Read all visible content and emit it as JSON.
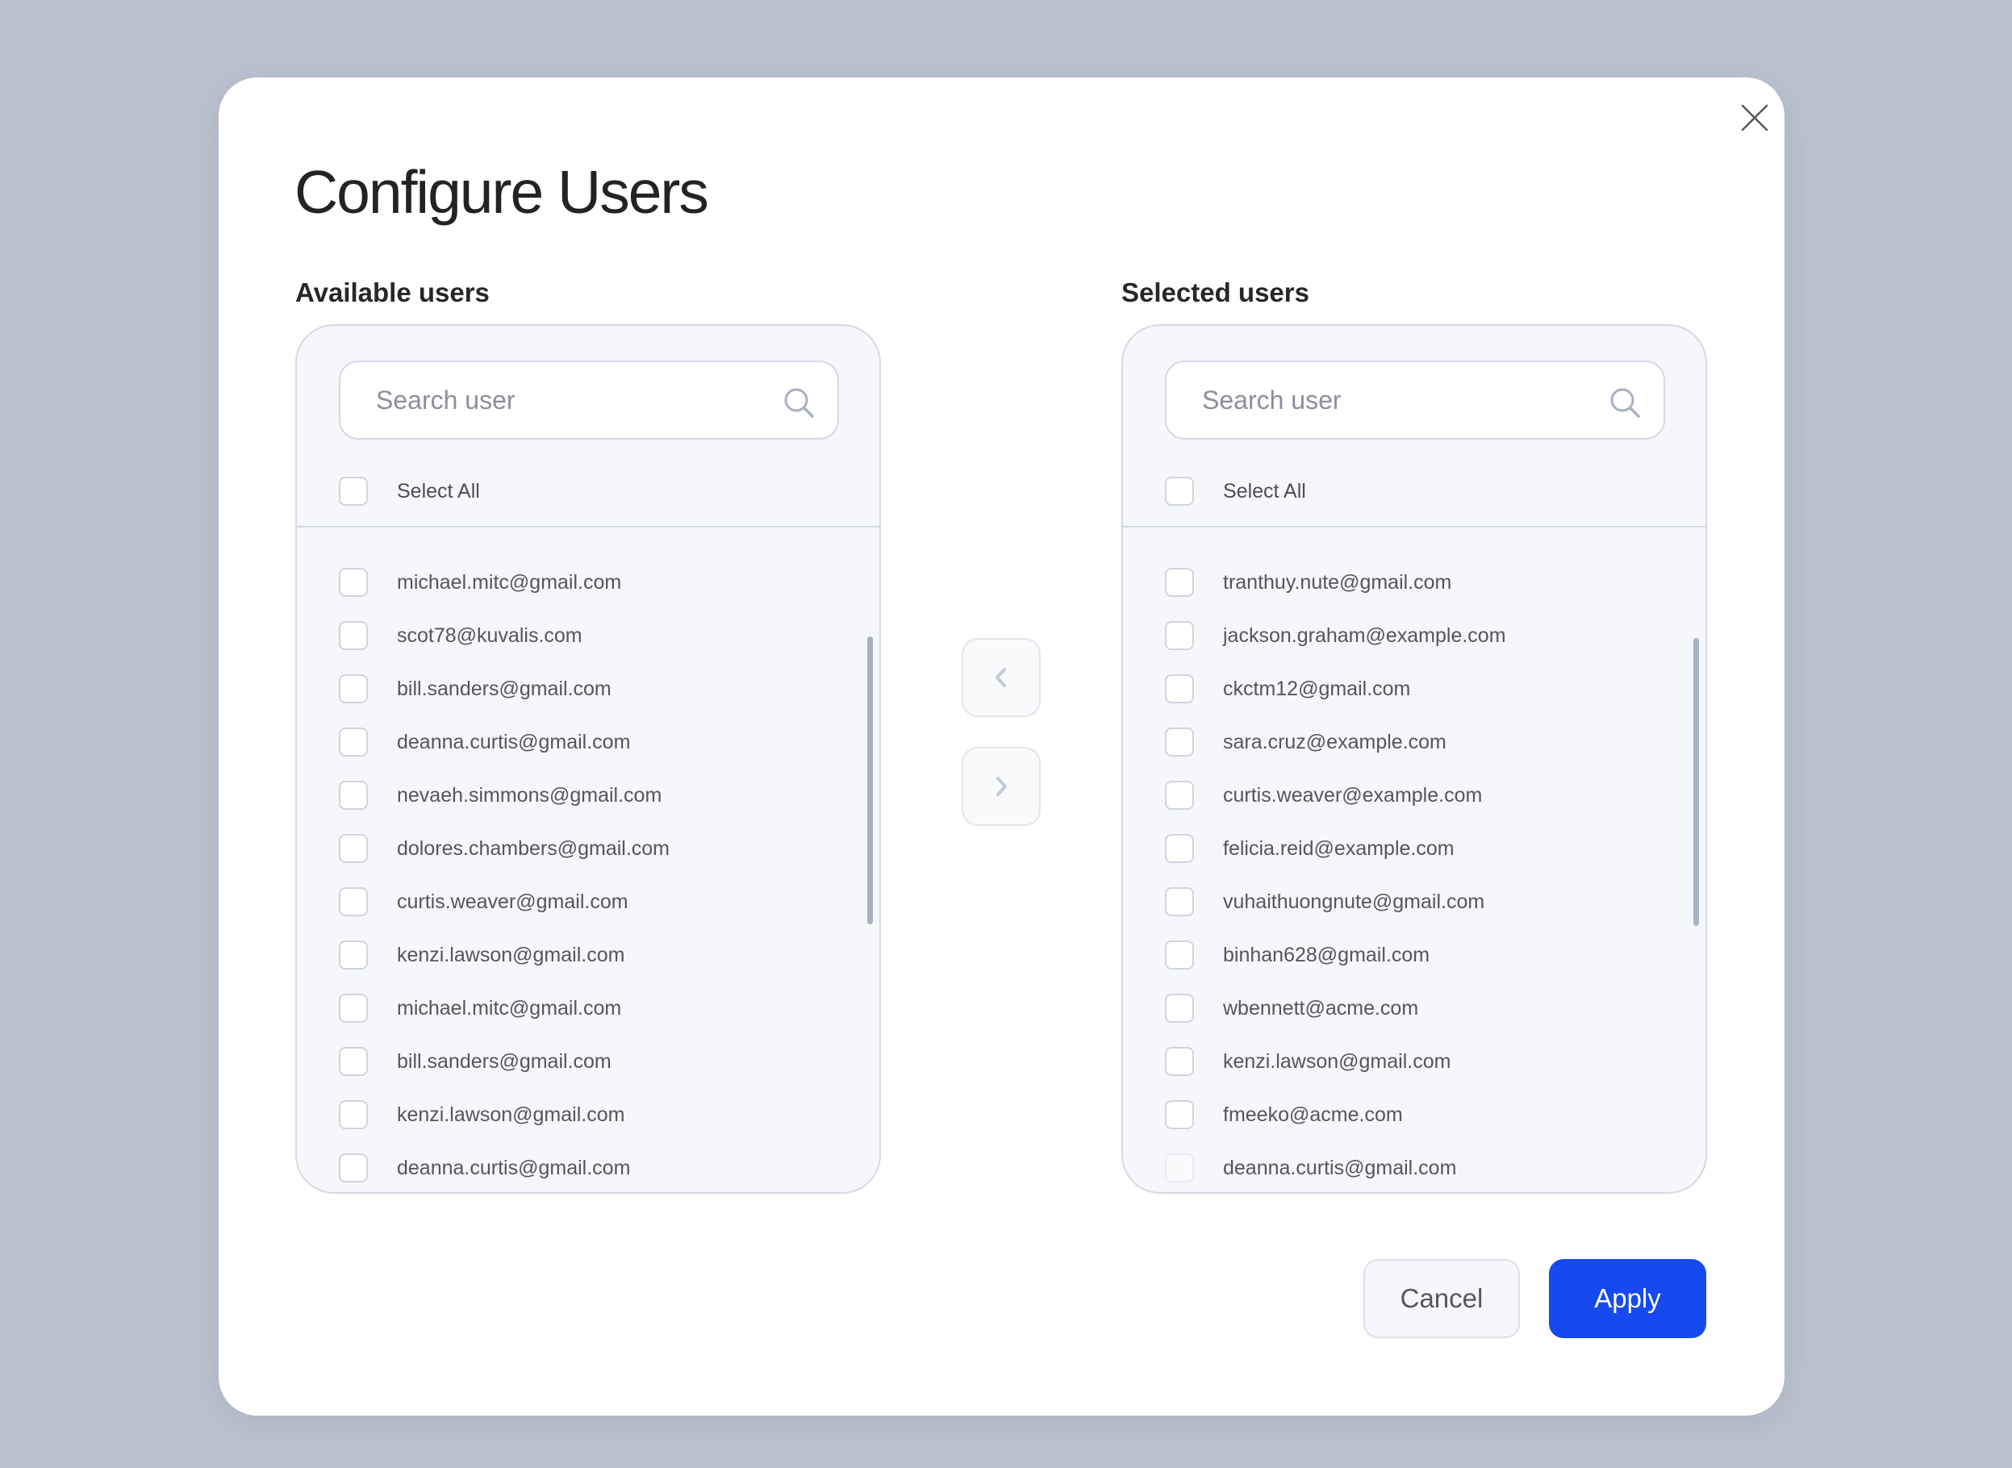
{
  "dialog": {
    "title": "Configure Users",
    "close_icon": "close-icon"
  },
  "available": {
    "label": "Available users",
    "search_placeholder": "Search user",
    "search_value": "",
    "select_all_label": "Select All",
    "select_all_checked": false,
    "items": [
      {
        "email": "michael.mitc@gmail.com",
        "checked": false
      },
      {
        "email": "scot78@kuvalis.com",
        "checked": false
      },
      {
        "email": "bill.sanders@gmail.com",
        "checked": false
      },
      {
        "email": "deanna.curtis@gmail.com",
        "checked": false
      },
      {
        "email": "nevaeh.simmons@gmail.com",
        "checked": false
      },
      {
        "email": "dolores.chambers@gmail.com",
        "checked": false
      },
      {
        "email": "curtis.weaver@gmail.com",
        "checked": false
      },
      {
        "email": "kenzi.lawson@gmail.com",
        "checked": false
      },
      {
        "email": "michael.mitc@gmail.com",
        "checked": false
      },
      {
        "email": "bill.sanders@gmail.com",
        "checked": false
      },
      {
        "email": "kenzi.lawson@gmail.com",
        "checked": false
      },
      {
        "email": "deanna.curtis@gmail.com",
        "checked": false
      }
    ]
  },
  "selected": {
    "label": "Selected users",
    "search_placeholder": "Search user",
    "search_value": "",
    "select_all_label": "Select All",
    "select_all_checked": false,
    "items": [
      {
        "email": "tranthuy.nute@gmail.com",
        "checked": false
      },
      {
        "email": "jackson.graham@example.com",
        "checked": false
      },
      {
        "email": "ckctm12@gmail.com",
        "checked": false
      },
      {
        "email": "sara.cruz@example.com",
        "checked": false
      },
      {
        "email": "curtis.weaver@example.com",
        "checked": false
      },
      {
        "email": "felicia.reid@example.com",
        "checked": false
      },
      {
        "email": "vuhaithuongnute@gmail.com",
        "checked": false
      },
      {
        "email": "binhan628@gmail.com",
        "checked": false
      },
      {
        "email": "wbennett@acme.com",
        "checked": false
      },
      {
        "email": "kenzi.lawson@gmail.com",
        "checked": false
      },
      {
        "email": "fmeeko@acme.com",
        "checked": false
      },
      {
        "email": "deanna.curtis@gmail.com",
        "checked": false
      }
    ]
  },
  "transfer": {
    "move_left_icon": "chevron-left-icon",
    "move_right_icon": "chevron-right-icon"
  },
  "footer": {
    "cancel_label": "Cancel",
    "apply_label": "Apply"
  },
  "colors": {
    "primary": "#1649ee",
    "backdrop": "#bbc1cf",
    "panel_bg": "#f6f7fb",
    "border": "#d5d9e2"
  }
}
